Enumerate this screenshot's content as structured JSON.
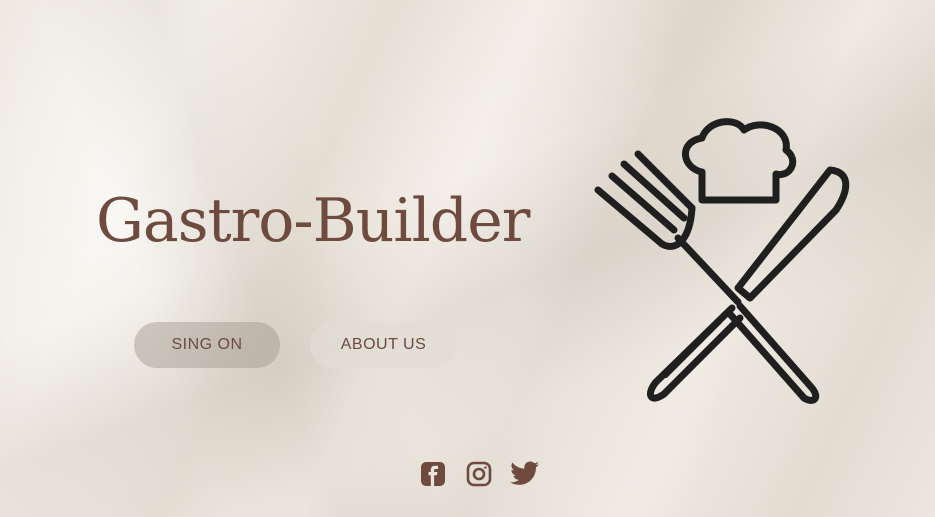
{
  "brand": {
    "title": "Gastro-Builder",
    "logo_icon": "chef-hat-fork-knife-icon"
  },
  "buttons": {
    "sign_on_label": "SING ON",
    "about_label": "ABOUT US"
  },
  "social": [
    {
      "icon": "facebook-icon"
    },
    {
      "icon": "instagram-icon"
    },
    {
      "icon": "twitter-icon"
    }
  ],
  "colors": {
    "brand": "#6e4a3f",
    "icon_dark": "#1f1f1f",
    "background": "#ebe6dd"
  }
}
